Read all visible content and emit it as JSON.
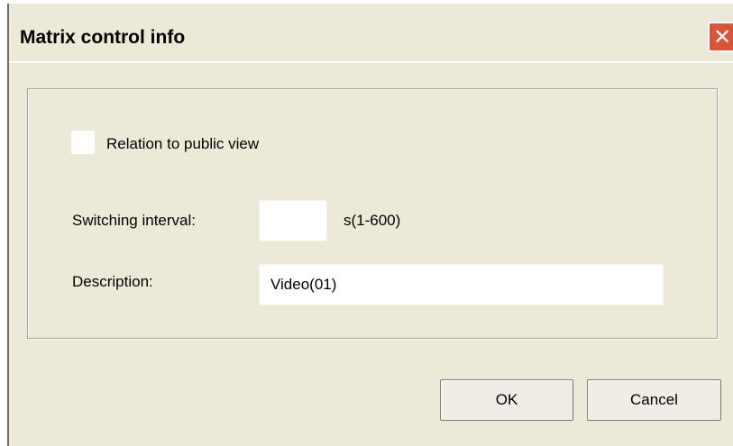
{
  "window": {
    "title": "Matrix control info",
    "close_glyph": "✕",
    "close_icon": "close-icon"
  },
  "form": {
    "relation_label": "Relation to public view",
    "relation_checked": false,
    "interval_label": "Switching interval:",
    "interval_value": "",
    "interval_unit": "s(1-600)",
    "description_label": "Description:",
    "description_value": "Video(01)"
  },
  "buttons": {
    "ok_label": "OK",
    "cancel_label": "Cancel"
  },
  "colors": {
    "dialog_bg": "#ece9d8",
    "close_button": "#d8553a"
  }
}
